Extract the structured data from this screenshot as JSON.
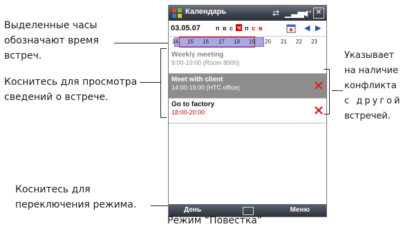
{
  "window": {
    "title": "Календарь"
  },
  "header": {
    "date": "03.05.07",
    "weekdays": [
      "п",
      "в",
      "с",
      "ч",
      "п",
      "с",
      "в"
    ],
    "current_index": 3
  },
  "hours": [
    "14",
    "15",
    "16",
    "17",
    "18",
    "19",
    "20",
    "21",
    "22",
    "23"
  ],
  "appointments": [
    {
      "title": "Weekly meeting",
      "time": "9:00-10:00 (Room 8000)",
      "state": "past"
    },
    {
      "title": "Meet with client",
      "time": "14:00-19:00 (HTC office)",
      "state": "selected",
      "conflict": true
    },
    {
      "title": "Go to factory",
      "time": "18:00-20:00",
      "state": "normal",
      "conflict": true
    }
  ],
  "softkeys": {
    "left": "День",
    "right": "Меню"
  },
  "annotations": {
    "hours": [
      "Выделенные часы",
      "обозначают время",
      "встреч."
    ],
    "tap_details": [
      "Коснитесь для просмотра",
      "сведений о встрече."
    ],
    "conflict": [
      "Указывает",
      "на наличие",
      "конфликта",
      "с другой",
      "встречей."
    ],
    "mode": [
      "Коснитесь для",
      "переключения режима."
    ]
  },
  "caption": "Режим “Повестка”"
}
